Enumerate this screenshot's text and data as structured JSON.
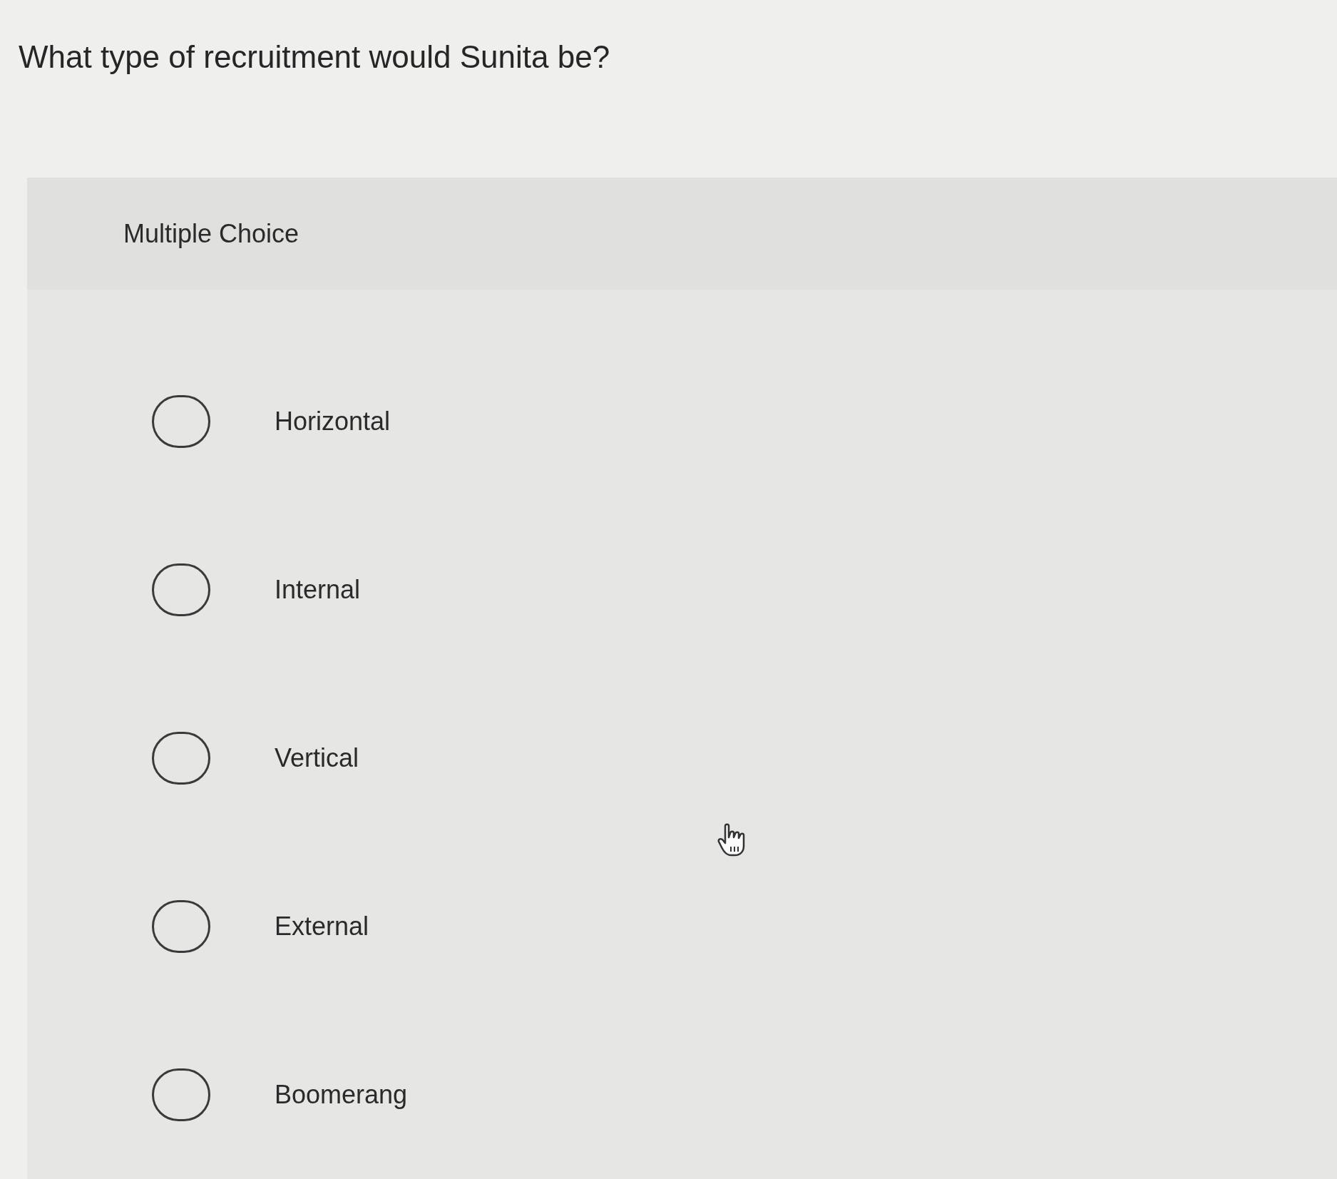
{
  "question": "What type of recruitment would Sunita be?",
  "panel": {
    "type_label": "Multiple Choice",
    "options": [
      {
        "label": "Horizontal",
        "selected": false
      },
      {
        "label": "Internal",
        "selected": false
      },
      {
        "label": "Vertical",
        "selected": false
      },
      {
        "label": "External",
        "selected": false
      },
      {
        "label": "Boomerang",
        "selected": false
      }
    ]
  }
}
